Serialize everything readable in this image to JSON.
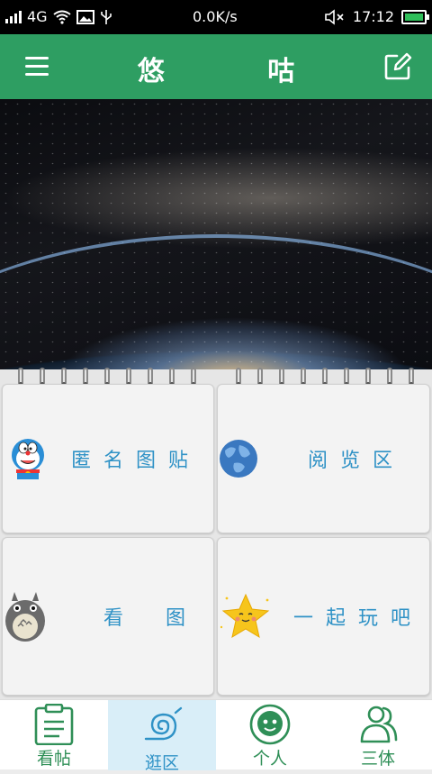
{
  "status_bar": {
    "network": "4G",
    "speed": "0.0K/s",
    "time": "17:12",
    "icons": [
      "signal-icon",
      "wifi-icon",
      "image-icon",
      "usb-icon",
      "mute-icon",
      "battery-icon"
    ]
  },
  "app_bar": {
    "title": "悠 咕",
    "menu_icon": "hamburger-menu-icon",
    "edit_icon": "edit-icon"
  },
  "banner": {
    "image": "earth-from-space-milky-way"
  },
  "cards": [
    {
      "label": "匿名图贴",
      "icon": "doraemon-icon"
    },
    {
      "label": "阅览区",
      "icon": "globe-icon"
    },
    {
      "label": "看 图",
      "icon": "totoro-icon"
    },
    {
      "label": "一起玩吧",
      "icon": "star-face-icon"
    }
  ],
  "tabs": [
    {
      "label": "看帖",
      "icon": "clipboard-icon",
      "active": false
    },
    {
      "label": "逛区",
      "icon": "spiral-icon",
      "active": true
    },
    {
      "label": "个人",
      "icon": "user-face-icon",
      "active": false
    },
    {
      "label": "三体",
      "icon": "group-users-icon",
      "active": false
    }
  ],
  "colors": {
    "primary_green": "#2e9e62",
    "label_blue": "#2f92c6",
    "tab_green": "#2f8f57",
    "active_tab_bg": "#d9eef8"
  }
}
